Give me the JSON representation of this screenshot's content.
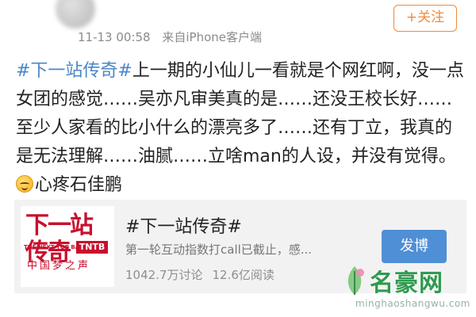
{
  "post": {
    "timestamp": "11-13 00:58",
    "source": "来自iPhone客户端",
    "topic": "#下一站传奇#",
    "body_line1": "上一期的小仙儿一看就是个网红啊，没一点女团的感觉……吴亦凡审美真的是……还没王校长好……至少人家看的比小什么的漂亮多了……还有丁立，我真的是无法理解……油腻……立啥man的人设，并没有觉得。",
    "emoji": "upside-down-smile-emoji",
    "body_line2": "心疼石佳鹏"
  },
  "follow_button": {
    "label": "+关注"
  },
  "card": {
    "logo": {
      "main_text": "下一站传奇",
      "english_text": "THE NEXT TOP BANG",
      "badge_text": "TNTB",
      "slogan": "中国梦之声"
    },
    "title": "#下一站传奇#",
    "description": "第一轮互动指数打call已截止，感...",
    "discussions": "1042.7万讨论",
    "reads": "12.6亿阅读",
    "post_button": "发博"
  },
  "watermark": {
    "text": "名豪网",
    "url": "minghaoshangwu.com"
  },
  "colors": {
    "topic_link": "#4a86c8",
    "follow_orange": "#f08a3a",
    "post_button_blue": "#4f8fd6",
    "card_background": "#f2f2f2",
    "logo_red": "#c8102e",
    "watermark_green": "#2f9a4f"
  }
}
